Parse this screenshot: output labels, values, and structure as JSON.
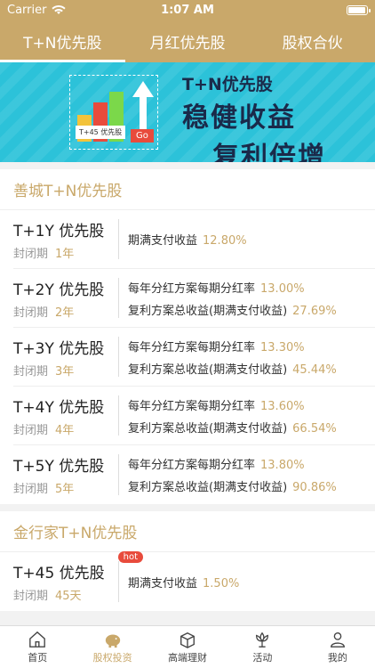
{
  "status": {
    "carrier": "Carrier",
    "time": "1:07 AM"
  },
  "tabs": [
    {
      "label": "T+N优先股",
      "active": true
    },
    {
      "label": "月红优先股",
      "active": false
    },
    {
      "label": "股权合伙",
      "active": false
    }
  ],
  "banner": {
    "line1": "T+N优先股",
    "line2": "稳健收益",
    "line3": "复利倍增",
    "card": "T+45 优先股",
    "go": "Go"
  },
  "sections": [
    {
      "title": "善城T+N优先股",
      "rows": [
        {
          "name": "T+1Y 优先股",
          "meta_label": "封闭期",
          "meta_value": "1年",
          "lines": [
            {
              "label": "期满支付收益",
              "rate": "12.80%"
            }
          ]
        },
        {
          "name": "T+2Y 优先股",
          "meta_label": "封闭期",
          "meta_value": "2年",
          "lines": [
            {
              "label": "每年分红方案每期分红率",
              "rate": "13.00%"
            },
            {
              "label": "复利方案总收益(期满支付收益)",
              "rate": "27.69%"
            }
          ]
        },
        {
          "name": "T+3Y 优先股",
          "meta_label": "封闭期",
          "meta_value": "3年",
          "lines": [
            {
              "label": "每年分红方案每期分红率",
              "rate": "13.30%"
            },
            {
              "label": "复利方案总收益(期满支付收益)",
              "rate": "45.44%"
            }
          ]
        },
        {
          "name": "T+4Y 优先股",
          "meta_label": "封闭期",
          "meta_value": "4年",
          "lines": [
            {
              "label": "每年分红方案每期分红率",
              "rate": "13.60%"
            },
            {
              "label": "复利方案总收益(期满支付收益)",
              "rate": "66.54%"
            }
          ]
        },
        {
          "name": "T+5Y 优先股",
          "meta_label": "封闭期",
          "meta_value": "5年",
          "lines": [
            {
              "label": "每年分红方案每期分红率",
              "rate": "13.80%"
            },
            {
              "label": "复利方案总收益(期满支付收益)",
              "rate": "90.86%"
            }
          ]
        }
      ]
    },
    {
      "title": "金行家T+N优先股",
      "rows": [
        {
          "name": "T+45 优先股",
          "hot": "hot",
          "meta_label": "封闭期",
          "meta_value": "45天",
          "lines": [
            {
              "label": "期满支付收益",
              "rate": "1.50%"
            }
          ]
        }
      ]
    }
  ],
  "nav": [
    {
      "label": "首页",
      "icon": "home-icon",
      "active": false
    },
    {
      "label": "股权投资",
      "icon": "piggy-bank-icon",
      "active": true
    },
    {
      "label": "高端理财",
      "icon": "box-icon",
      "active": false
    },
    {
      "label": "活动",
      "icon": "flower-icon",
      "active": false
    },
    {
      "label": "我的",
      "icon": "user-icon",
      "active": false
    }
  ],
  "colors": {
    "accent": "#c9a86a",
    "banner": "#2cc2d9",
    "hot": "#e84b3c"
  }
}
